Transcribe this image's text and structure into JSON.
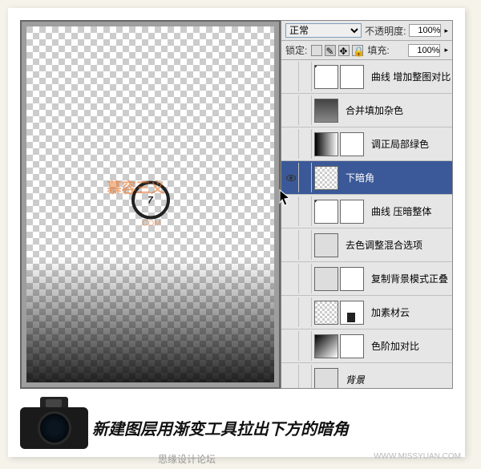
{
  "blend_mode": "正常",
  "opacity_label": "不透明度:",
  "opacity_value": "100%",
  "lock_label": "锁定:",
  "fill_label": "填充:",
  "fill_value": "100%",
  "step_number": "7",
  "watermark_brand": "慕容三义",
  "watermark_sub": ".COM",
  "caption": "新建图层用渐变工具拉出下方的暗角",
  "footer_left": "思缘设计论坛",
  "footer_right": "WWW.MISSYUAN.COM",
  "layers": [
    {
      "name": "曲线 增加整图对比",
      "t1": "curves",
      "t2": "mask"
    },
    {
      "name": "合并填加杂色",
      "t1": "img1",
      "t2": ""
    },
    {
      "name": "调正局部绿色",
      "t1": "grad-h",
      "t2": "mask"
    },
    {
      "name": "下暗角",
      "t1": "checker",
      "t2": "",
      "selected": true,
      "eye": true
    },
    {
      "name": "曲线 压暗整体",
      "t1": "curves",
      "t2": "mask"
    },
    {
      "name": "去色调整混合选项",
      "t1": "img2",
      "t2": ""
    },
    {
      "name": "复制背景模式正叠",
      "t1": "img2",
      "t2": "mask"
    },
    {
      "name": "加素材云",
      "t1": "checker",
      "t2": "maskb"
    },
    {
      "name": "色阶加对比",
      "t1": "grad-diag",
      "t2": "mask"
    },
    {
      "name": "背景",
      "t1": "img2",
      "t2": "",
      "italic": true
    }
  ]
}
